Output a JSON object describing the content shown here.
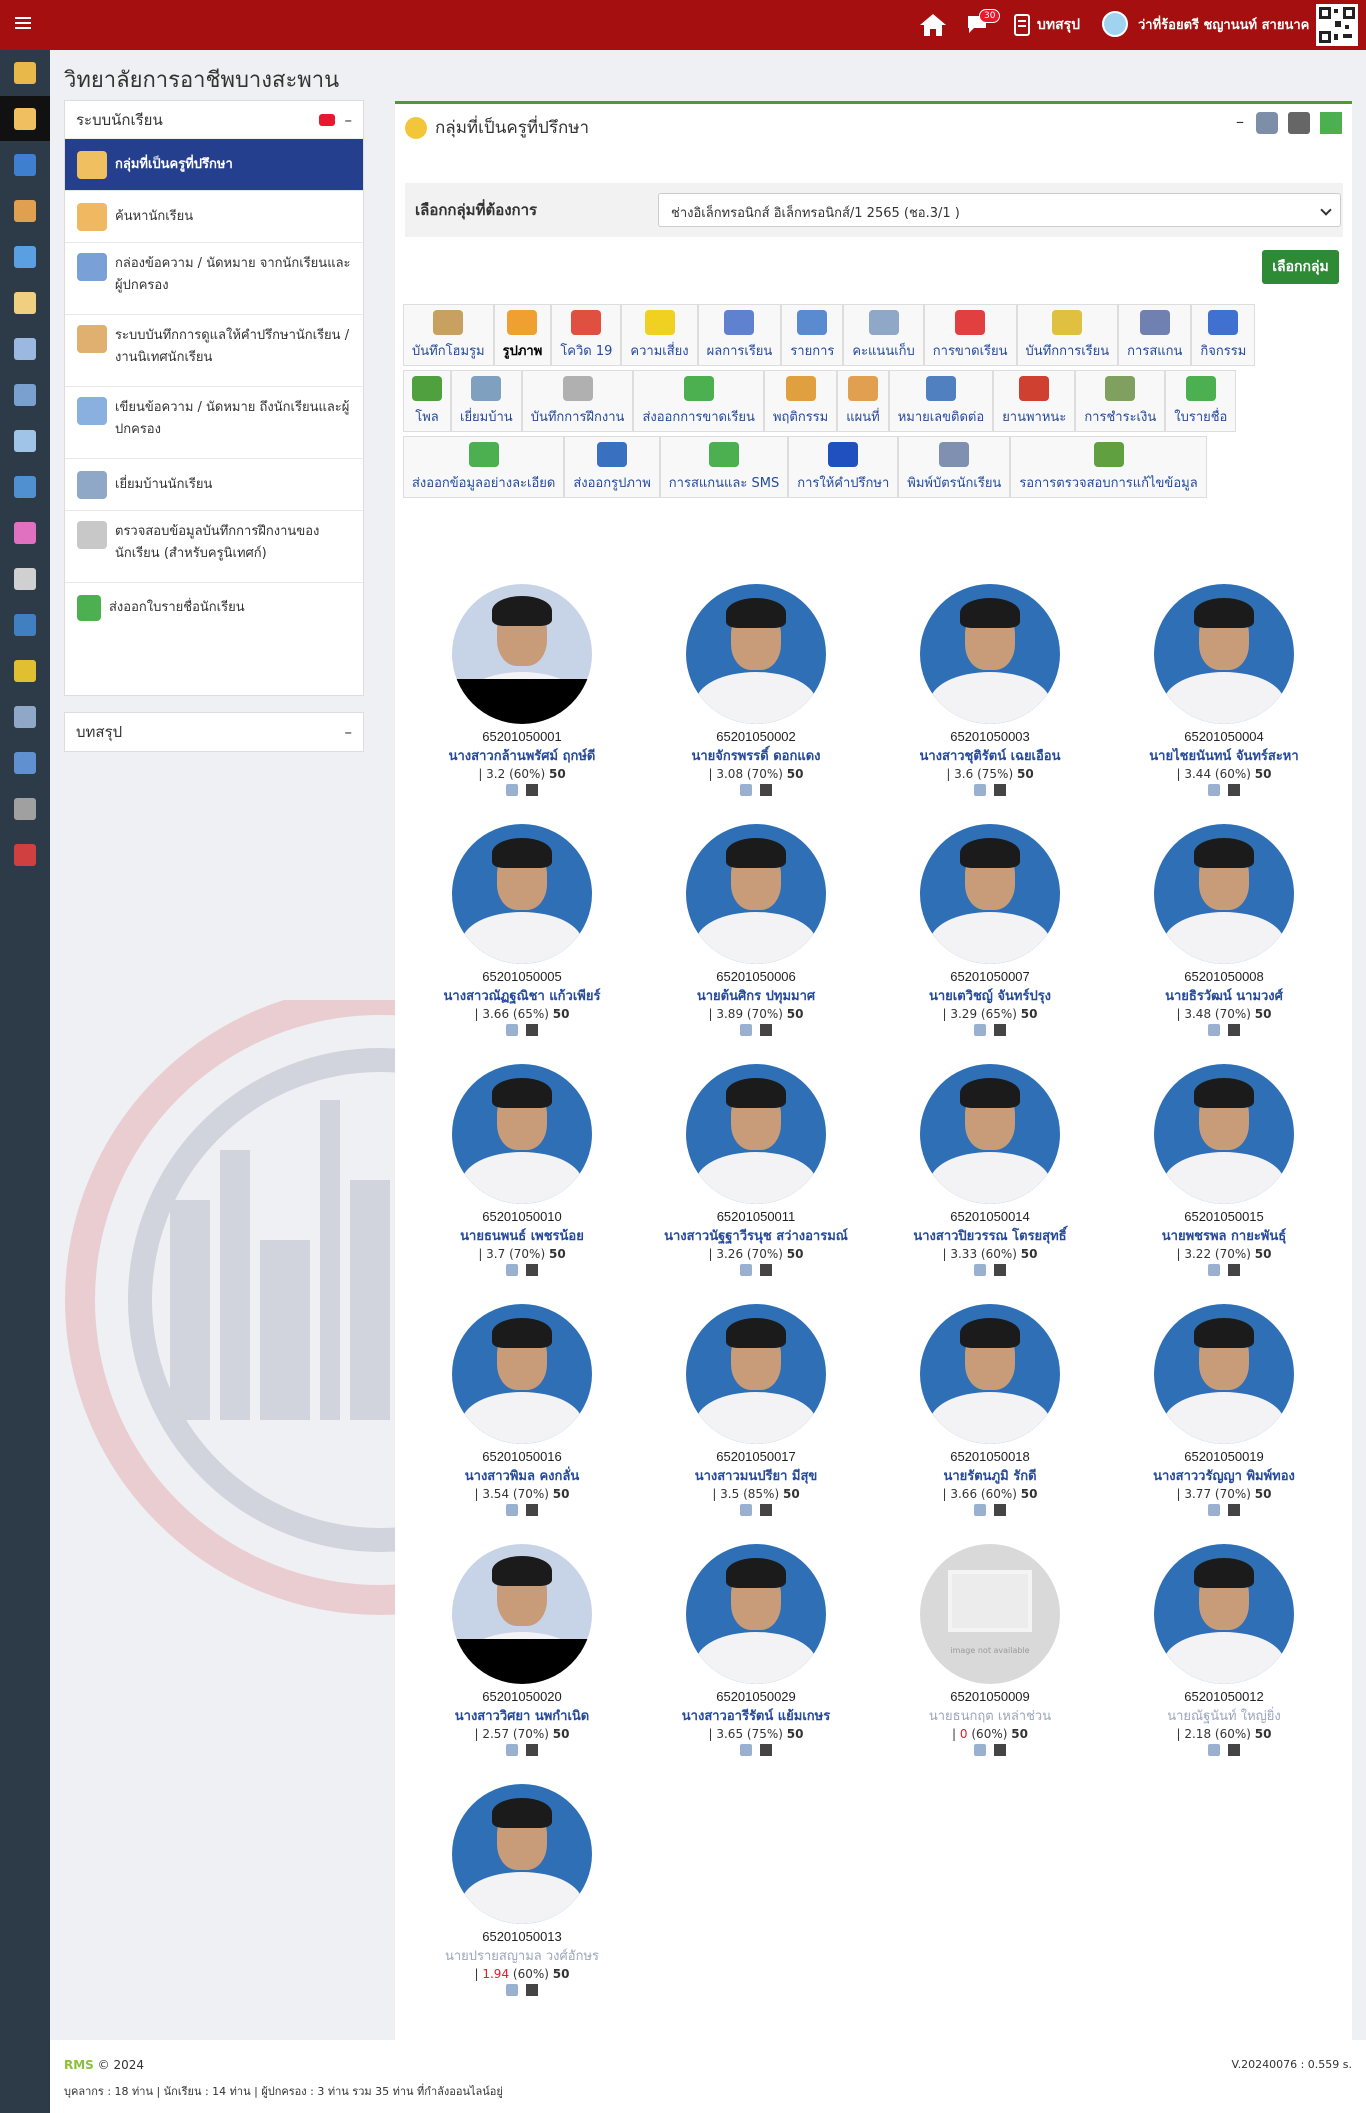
{
  "topbar": {
    "notif_count": "30",
    "summary_label": "บทสรุป",
    "user_name": "ว่าที่ร้อยตรี ชญานนท์ สายนาค"
  },
  "school_title": "วิทยาลัยการอาชีพบางสะพาน",
  "sidebar": {
    "panel_title": "ระบบนักเรียน",
    "items": [
      {
        "label": "กลุ่มที่เป็นครูที่ปรึกษา"
      },
      {
        "label": "ค้นหานักเรียน"
      },
      {
        "label": "กล่องข้อความ / นัดหมาย จากนักเรียนและผู้ปกครอง"
      },
      {
        "label": "ระบบบันทึกการดูแลให้คำปรึกษานักเรียน / งานนิเทศนักเรียน"
      },
      {
        "label": "เขียนข้อความ / นัดหมาย ถึงนักเรียนและผู้ปกครอง"
      },
      {
        "label": "เยี่ยมบ้านนักเรียน"
      },
      {
        "label": "ตรวจสอบข้อมูลบันทึกการฝึกงานของนักเรียน (สำหรับครูนิเทศก์)"
      },
      {
        "label": "ส่งออกใบรายชื่อนักเรียน"
      }
    ],
    "summary_panel_title": "บทสรุป"
  },
  "content": {
    "title": "กลุ่มที่เป็นครูที่ปรึกษา",
    "select_label": "เลือกกลุ่มที่ต้องการ",
    "select_value": "ช่างอิเล็กทรอนิกส์ อิเล็กทรอนิกส์/1 2565 (ชอ.3/1 )",
    "select_button": "เลือกกลุ่ม"
  },
  "tools": {
    "row1": [
      "บันทึกโฮมรูม",
      "รูปภาพ",
      "โควิด 19",
      "ความเสี่ยง",
      "ผลการเรียน",
      "รายการ",
      "คะแนนเก็บ",
      "การขาดเรียน",
      "บันทึกการเรียน",
      "การสแกน",
      "กิจกรรม"
    ],
    "row2": [
      "โพล",
      "เยี่ยมบ้าน",
      "บันทึกการฝึกงาน",
      "ส่งออกการขาดเรียน",
      "พฤติกรรม",
      "แผนที่",
      "หมายเลขติดต่อ",
      "ยานพาหนะ",
      "การชำระเงิน",
      "ใบรายชื่อ"
    ],
    "row3": [
      "ส่งออกข้อมูลอย่างละเอียด",
      "ส่งออกรูปภาพ",
      "การสแกนและ SMS",
      "การให้คำปรึกษา",
      "พิมพ์บัตรนักเรียน",
      "รอการตรวจสอบการแก้ไขข้อมูล"
    ]
  },
  "students": [
    {
      "id": "65201050001",
      "name": "นางสาวกล้านพรัศม์ ฤกษ์ดี",
      "gpa": "3.2",
      "pct": "(60%)",
      "score": "50",
      "photo": "half"
    },
    {
      "id": "65201050002",
      "name": "นายจักรพรรดิ์ ดอกแดง",
      "gpa": "3.08",
      "pct": "(70%)",
      "score": "50",
      "photo": "normal"
    },
    {
      "id": "65201050003",
      "name": "นางสาวชุติรัตน์ เฉยเอือน",
      "gpa": "3.6",
      "pct": "(75%)",
      "score": "50",
      "photo": "normal"
    },
    {
      "id": "65201050004",
      "name": "นายไชยนันทน์ จันทร์สะหา",
      "gpa": "3.44",
      "pct": "(60%)",
      "score": "50",
      "photo": "normal"
    },
    {
      "id": "65201050005",
      "name": "นางสาวณัฏฐณิชา แก้วเพียร์",
      "gpa": "3.66",
      "pct": "(65%)",
      "score": "50",
      "photo": "normal"
    },
    {
      "id": "65201050006",
      "name": "นายต้นศิกร ปทุมมาศ",
      "gpa": "3.89",
      "pct": "(70%)",
      "score": "50",
      "photo": "normal"
    },
    {
      "id": "65201050007",
      "name": "นายเตวิชญ์ จันทร์ปรุง",
      "gpa": "3.29",
      "pct": "(65%)",
      "score": "50",
      "photo": "normal"
    },
    {
      "id": "65201050008",
      "name": "นายธิรวัฒน์ นามวงศ์",
      "gpa": "3.48",
      "pct": "(70%)",
      "score": "50",
      "photo": "normal"
    },
    {
      "id": "65201050010",
      "name": "นายธนพนธ์ เพชรน้อย",
      "gpa": "3.7",
      "pct": "(70%)",
      "score": "50",
      "photo": "normal"
    },
    {
      "id": "65201050011",
      "name": "นางสาวนัฐฐาวีรนุช สว่างอารมณ์",
      "gpa": "3.26",
      "pct": "(70%)",
      "score": "50",
      "photo": "normal"
    },
    {
      "id": "65201050014",
      "name": "นางสาวปิยวรรณ โตรยสุทธิ์",
      "gpa": "3.33",
      "pct": "(60%)",
      "score": "50",
      "photo": "normal"
    },
    {
      "id": "65201050015",
      "name": "นายพชรพล กายะพันธุ์",
      "gpa": "3.22",
      "pct": "(70%)",
      "score": "50",
      "photo": "normal"
    },
    {
      "id": "65201050016",
      "name": "นางสาวพิมล คงกลั่น",
      "gpa": "3.54",
      "pct": "(70%)",
      "score": "50",
      "photo": "normal"
    },
    {
      "id": "65201050017",
      "name": "นางสาวมนปรียา มีสุข",
      "gpa": "3.5",
      "pct": "(85%)",
      "score": "50",
      "photo": "normal"
    },
    {
      "id": "65201050018",
      "name": "นายรัตนภูมิ รักดี",
      "gpa": "3.66",
      "pct": "(60%)",
      "score": "50",
      "photo": "normal"
    },
    {
      "id": "65201050019",
      "name": "นางสาววรัญญา พิมพ์ทอง",
      "gpa": "3.77",
      "pct": "(70%)",
      "score": "50",
      "photo": "normal"
    },
    {
      "id": "65201050020",
      "name": "นางสาววิศยา นพกำเนิด",
      "gpa": "2.57",
      "pct": "(70%)",
      "score": "50",
      "photo": "half"
    },
    {
      "id": "65201050029",
      "name": "นางสาวอารีรัตน์ แย้มเกษร",
      "gpa": "3.65",
      "pct": "(75%)",
      "score": "50",
      "photo": "normal"
    },
    {
      "id": "65201050009",
      "name": "นายธนกฤต เหล่าช่วน",
      "gpa": "0",
      "pct": "(60%)",
      "score": "50",
      "photo": "none",
      "gray": true,
      "red": true
    },
    {
      "id": "65201050012",
      "name": "นายณัฐนันท์ ใหญ่ยิ่ง",
      "gpa": "2.18",
      "pct": "(60%)",
      "score": "50",
      "photo": "normal",
      "gray": true
    },
    {
      "id": "65201050013",
      "name": "นายปรายสญามล วงศ์อักษร",
      "gpa": "1.94",
      "pct": "(60%)",
      "score": "50",
      "photo": "normal",
      "gray": true,
      "red": true
    }
  ],
  "no_image_text": "image not available",
  "footer": {
    "brand": "RMS",
    "copyright": "© 2024",
    "stats": "บุคลากร : 18 ท่าน | นักเรียน : 14 ท่าน | ผู้ปกครอง : 3 ท่าน รวม 35 ท่าน ที่กำลังออนไลน์อยู่",
    "version": "V.20240076 : 0.559 s."
  }
}
